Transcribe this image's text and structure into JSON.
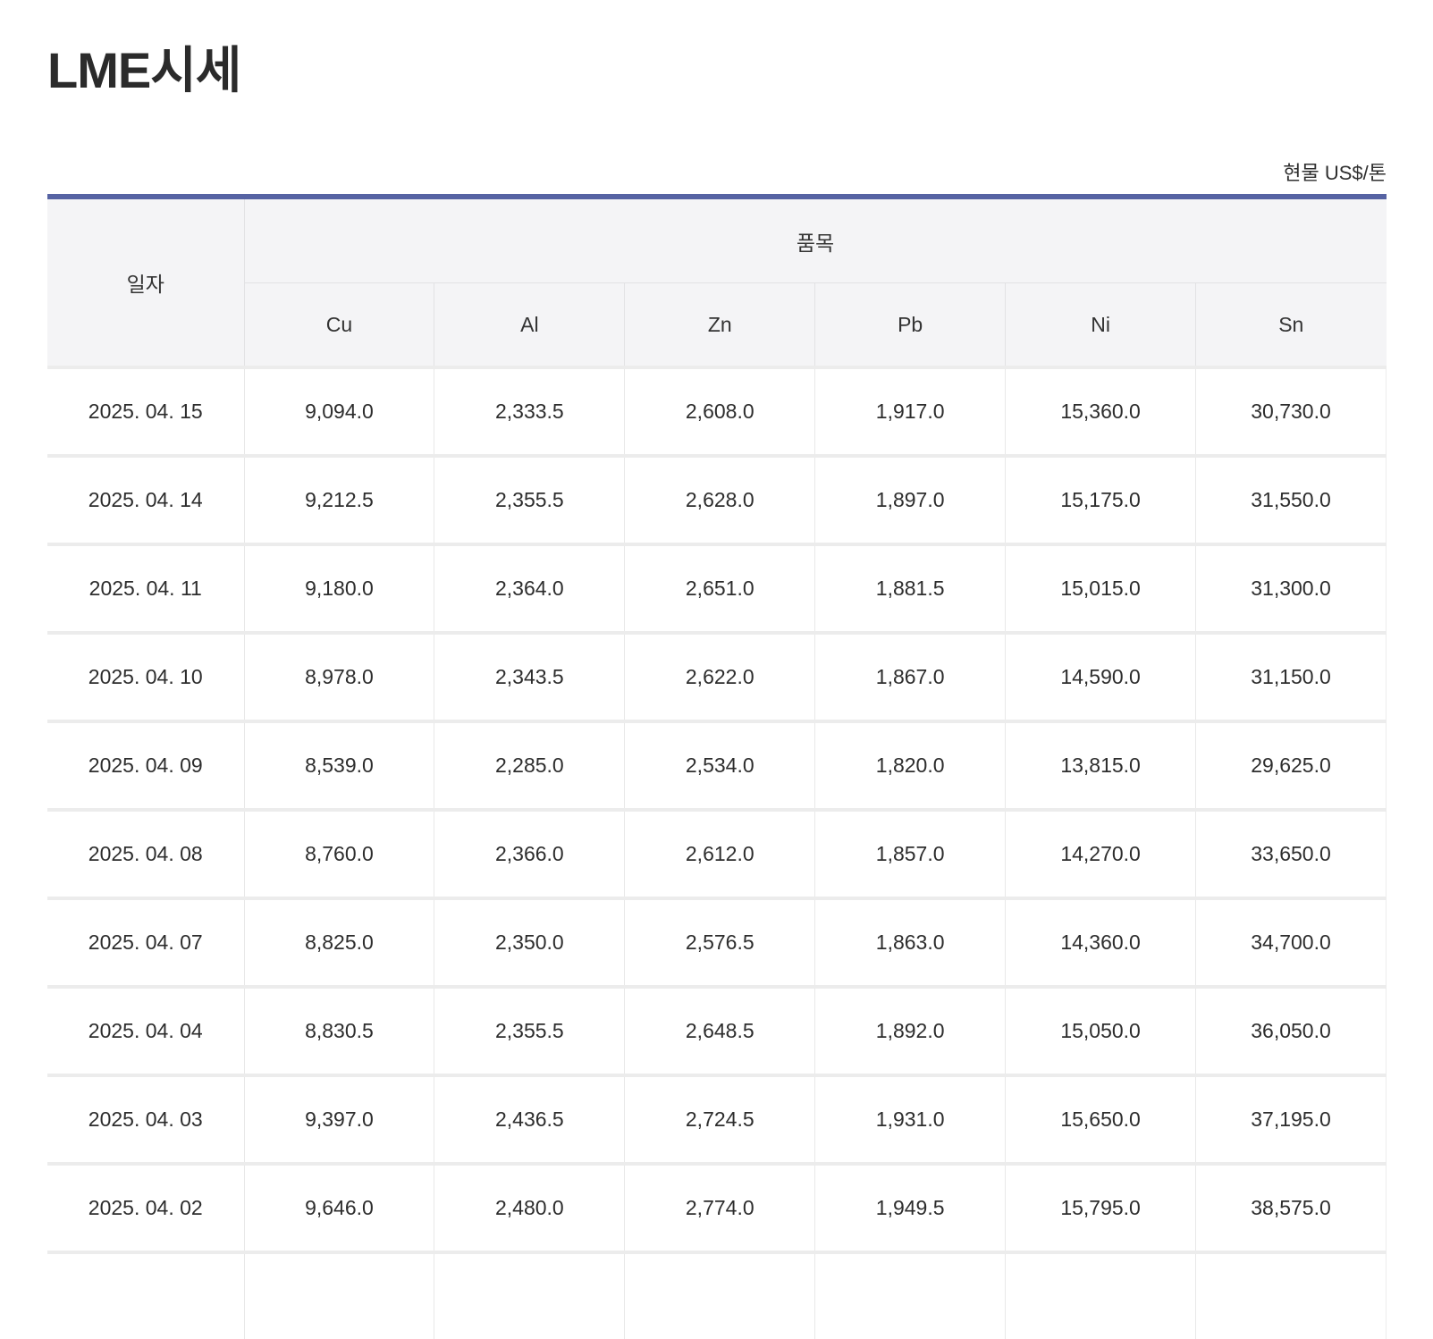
{
  "page": {
    "title": "LME시세",
    "unit_label": "현물 US$/톤"
  },
  "table": {
    "date_header": "일자",
    "group_header": "품목",
    "columns": [
      "Cu",
      "Al",
      "Zn",
      "Pb",
      "Ni",
      "Sn"
    ],
    "rows": [
      {
        "date": "2025. 04. 15",
        "values": [
          "9,094.0",
          "2,333.5",
          "2,608.0",
          "1,917.0",
          "15,360.0",
          "30,730.0"
        ]
      },
      {
        "date": "2025. 04. 14",
        "values": [
          "9,212.5",
          "2,355.5",
          "2,628.0",
          "1,897.0",
          "15,175.0",
          "31,550.0"
        ]
      },
      {
        "date": "2025. 04. 11",
        "values": [
          "9,180.0",
          "2,364.0",
          "2,651.0",
          "1,881.5",
          "15,015.0",
          "31,300.0"
        ]
      },
      {
        "date": "2025. 04. 10",
        "values": [
          "8,978.0",
          "2,343.5",
          "2,622.0",
          "1,867.0",
          "14,590.0",
          "31,150.0"
        ]
      },
      {
        "date": "2025. 04. 09",
        "values": [
          "8,539.0",
          "2,285.0",
          "2,534.0",
          "1,820.0",
          "13,815.0",
          "29,625.0"
        ]
      },
      {
        "date": "2025. 04. 08",
        "values": [
          "8,760.0",
          "2,366.0",
          "2,612.0",
          "1,857.0",
          "14,270.0",
          "33,650.0"
        ]
      },
      {
        "date": "2025. 04. 07",
        "values": [
          "8,825.0",
          "2,350.0",
          "2,576.5",
          "1,863.0",
          "14,360.0",
          "34,700.0"
        ]
      },
      {
        "date": "2025. 04. 04",
        "values": [
          "8,830.5",
          "2,355.5",
          "2,648.5",
          "1,892.0",
          "15,050.0",
          "36,050.0"
        ]
      },
      {
        "date": "2025. 04. 03",
        "values": [
          "9,397.0",
          "2,436.5",
          "2,724.5",
          "1,931.0",
          "15,650.0",
          "37,195.0"
        ]
      },
      {
        "date": "2025. 04. 02",
        "values": [
          "9,646.0",
          "2,480.0",
          "2,774.0",
          "1,949.5",
          "15,795.0",
          "38,575.0"
        ]
      }
    ]
  },
  "colors": {
    "accent": "#5663a3",
    "header_bg": "#f4f4f6",
    "date_bg": "#e8edf2"
  }
}
